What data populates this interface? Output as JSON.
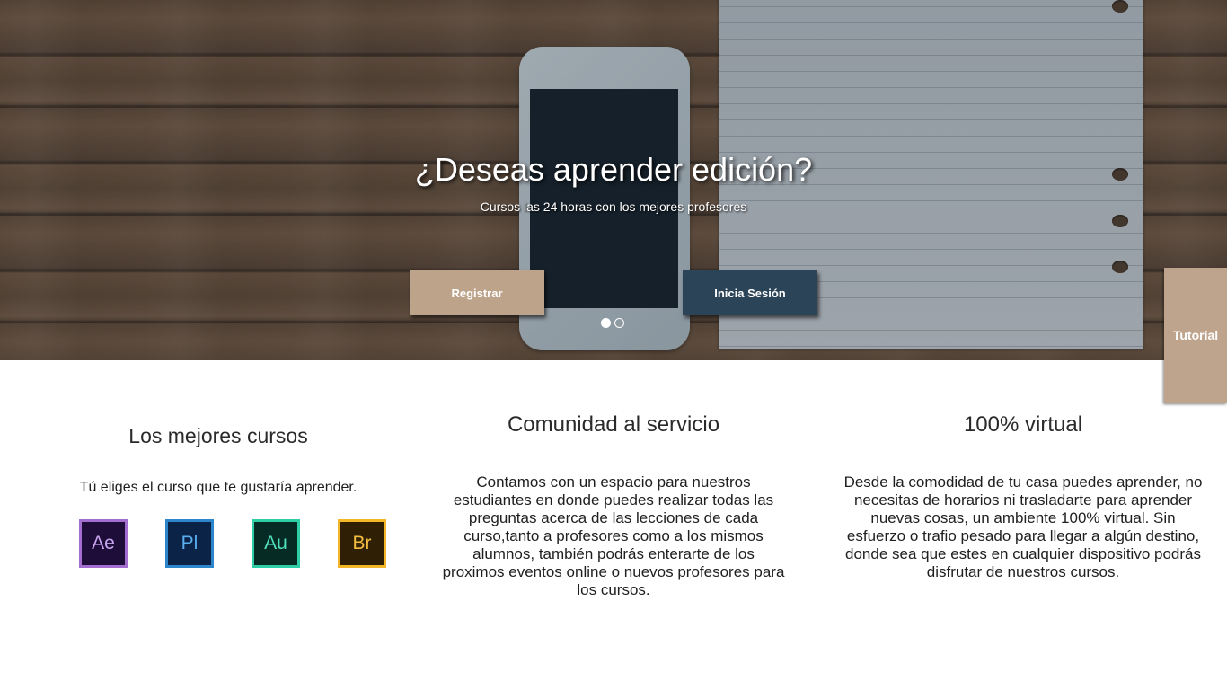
{
  "hero": {
    "title": "¿Deseas aprender edición?",
    "subtitle": "Cursos las 24 horas con los mejores profesores",
    "register_label": "Registrar",
    "login_label": "Inicia Sesión",
    "slides": 2,
    "active_slide": 1
  },
  "tutorial_tab": {
    "label": "Tutorial"
  },
  "features": [
    {
      "title": "Los mejores cursos",
      "text": "Tú eliges el curso que te gustaría aprender.",
      "apps": [
        {
          "label": "Ae",
          "icon": "after-effects-icon",
          "color": "#a46ed1"
        },
        {
          "label": "Pl",
          "icon": "prelude-icon",
          "color": "#2d86cc"
        },
        {
          "label": "Au",
          "icon": "audition-icon",
          "color": "#2ecfa7"
        },
        {
          "label": "Br",
          "icon": "bridge-icon",
          "color": "#f4b629"
        }
      ]
    },
    {
      "title": "Comunidad al servicio",
      "text": "Contamos con un espacio para nuestros estudiantes en donde puedes realizar todas las preguntas acerca de las lecciones de cada curso,tanto a profesores como a los mismos alumnos, también podrás enterarte de los proximos eventos online o nuevos profesores para los cursos."
    },
    {
      "title": "100% virtual",
      "text": "Desde la comodidad de tu casa puedes aprender, no necesitas de horarios ni trasladarte para aprender nuevas cosas, un ambiente 100% virtual. Sin esfuerzo o trafio pesado para llegar a algún destino, donde sea que estes en cualquier dispositivo podrás disfrutar de nuestros cursos."
    }
  ],
  "colors": {
    "register_button": "#bda38a",
    "login_button": "#2c4457",
    "tutorial_tab": "#bea48c"
  }
}
